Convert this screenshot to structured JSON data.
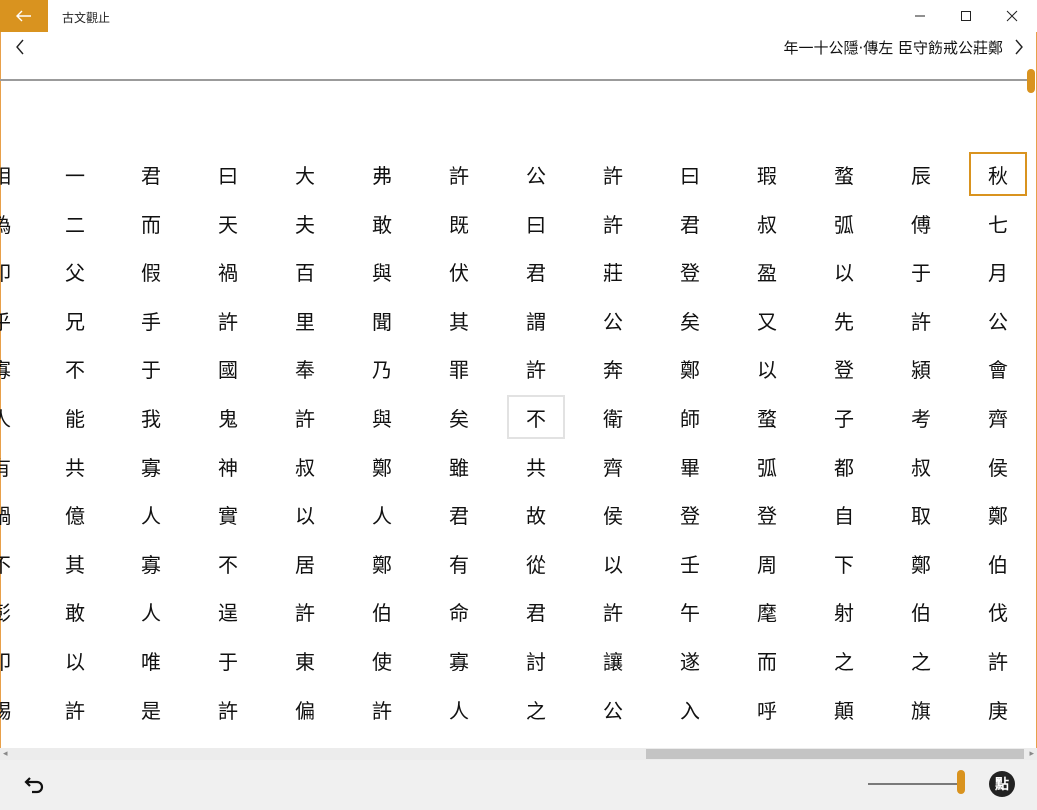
{
  "window": {
    "title": "古文觀止"
  },
  "nav": {
    "chapter_title": "年一十公隱·傳左 臣守飭戒公莊鄭"
  },
  "reader": {
    "columns": [
      {
        "chars": [
          "相",
          "偽",
          "叩",
          "乎",
          "寡",
          "人",
          "有",
          "鍋",
          "不",
          "彭",
          "叩",
          "賜"
        ]
      },
      {
        "chars": [
          "一",
          "二",
          "父",
          "兄",
          "不",
          "能",
          "共",
          "億",
          "其",
          "敢",
          "以",
          "許"
        ]
      },
      {
        "chars": [
          "君",
          "而",
          "假",
          "手",
          "于",
          "我",
          "寡",
          "人",
          "寡",
          "人",
          "唯",
          "是"
        ]
      },
      {
        "chars": [
          "曰",
          "天",
          "禍",
          "許",
          "國",
          "鬼",
          "神",
          "實",
          "不",
          "逞",
          "于",
          "許"
        ]
      },
      {
        "chars": [
          "大",
          "夫",
          "百",
          "里",
          "奉",
          "許",
          "叔",
          "以",
          "居",
          "許",
          "東",
          "偏"
        ]
      },
      {
        "chars": [
          "弗",
          "敢",
          "與",
          "聞",
          "乃",
          "與",
          "鄭",
          "人",
          "鄭",
          "伯",
          "使",
          "許"
        ]
      },
      {
        "chars": [
          "許",
          "既",
          "伏",
          "其",
          "罪",
          "矣",
          "雖",
          "君",
          "有",
          "命",
          "寡",
          "人"
        ]
      },
      {
        "chars": [
          "公",
          "曰",
          "君",
          "謂",
          "許",
          "不",
          "共",
          "故",
          "從",
          "君",
          "討",
          "之"
        ]
      },
      {
        "chars": [
          "許",
          "許",
          "莊",
          "公",
          "奔",
          "衛",
          "齊",
          "侯",
          "以",
          "許",
          "讓",
          "公"
        ]
      },
      {
        "chars": [
          "曰",
          "君",
          "登",
          "矣",
          "鄭",
          "師",
          "畢",
          "登",
          "壬",
          "午",
          "遂",
          "入"
        ]
      },
      {
        "chars": [
          "瑕",
          "叔",
          "盈",
          "又",
          "以",
          "蝥",
          "弧",
          "登",
          "周",
          "麾",
          "而",
          "呼"
        ]
      },
      {
        "chars": [
          "蝥",
          "弧",
          "以",
          "先",
          "登",
          "子",
          "都",
          "自",
          "下",
          "射",
          "之",
          "顛"
        ]
      },
      {
        "chars": [
          "辰",
          "傅",
          "于",
          "許",
          "潁",
          "考",
          "叔",
          "取",
          "鄭",
          "伯",
          "之",
          "旗"
        ]
      },
      {
        "chars": [
          "秋",
          "七",
          "月",
          "公",
          "會",
          "齊",
          "侯",
          "鄭",
          "伯",
          "伐",
          "許",
          "庚"
        ]
      }
    ],
    "selected_column": 13,
    "selected_row": 0,
    "hover_column": 7,
    "hover_row": 5
  },
  "toolbar": {
    "punctuation_label": "點"
  },
  "colors": {
    "accent": "#d9931f",
    "border": "#e8a04a"
  },
  "icons": {
    "back": "arrow-left-icon",
    "prev": "chevron-left-icon",
    "next": "chevron-right-icon",
    "undo": "undo-icon"
  }
}
